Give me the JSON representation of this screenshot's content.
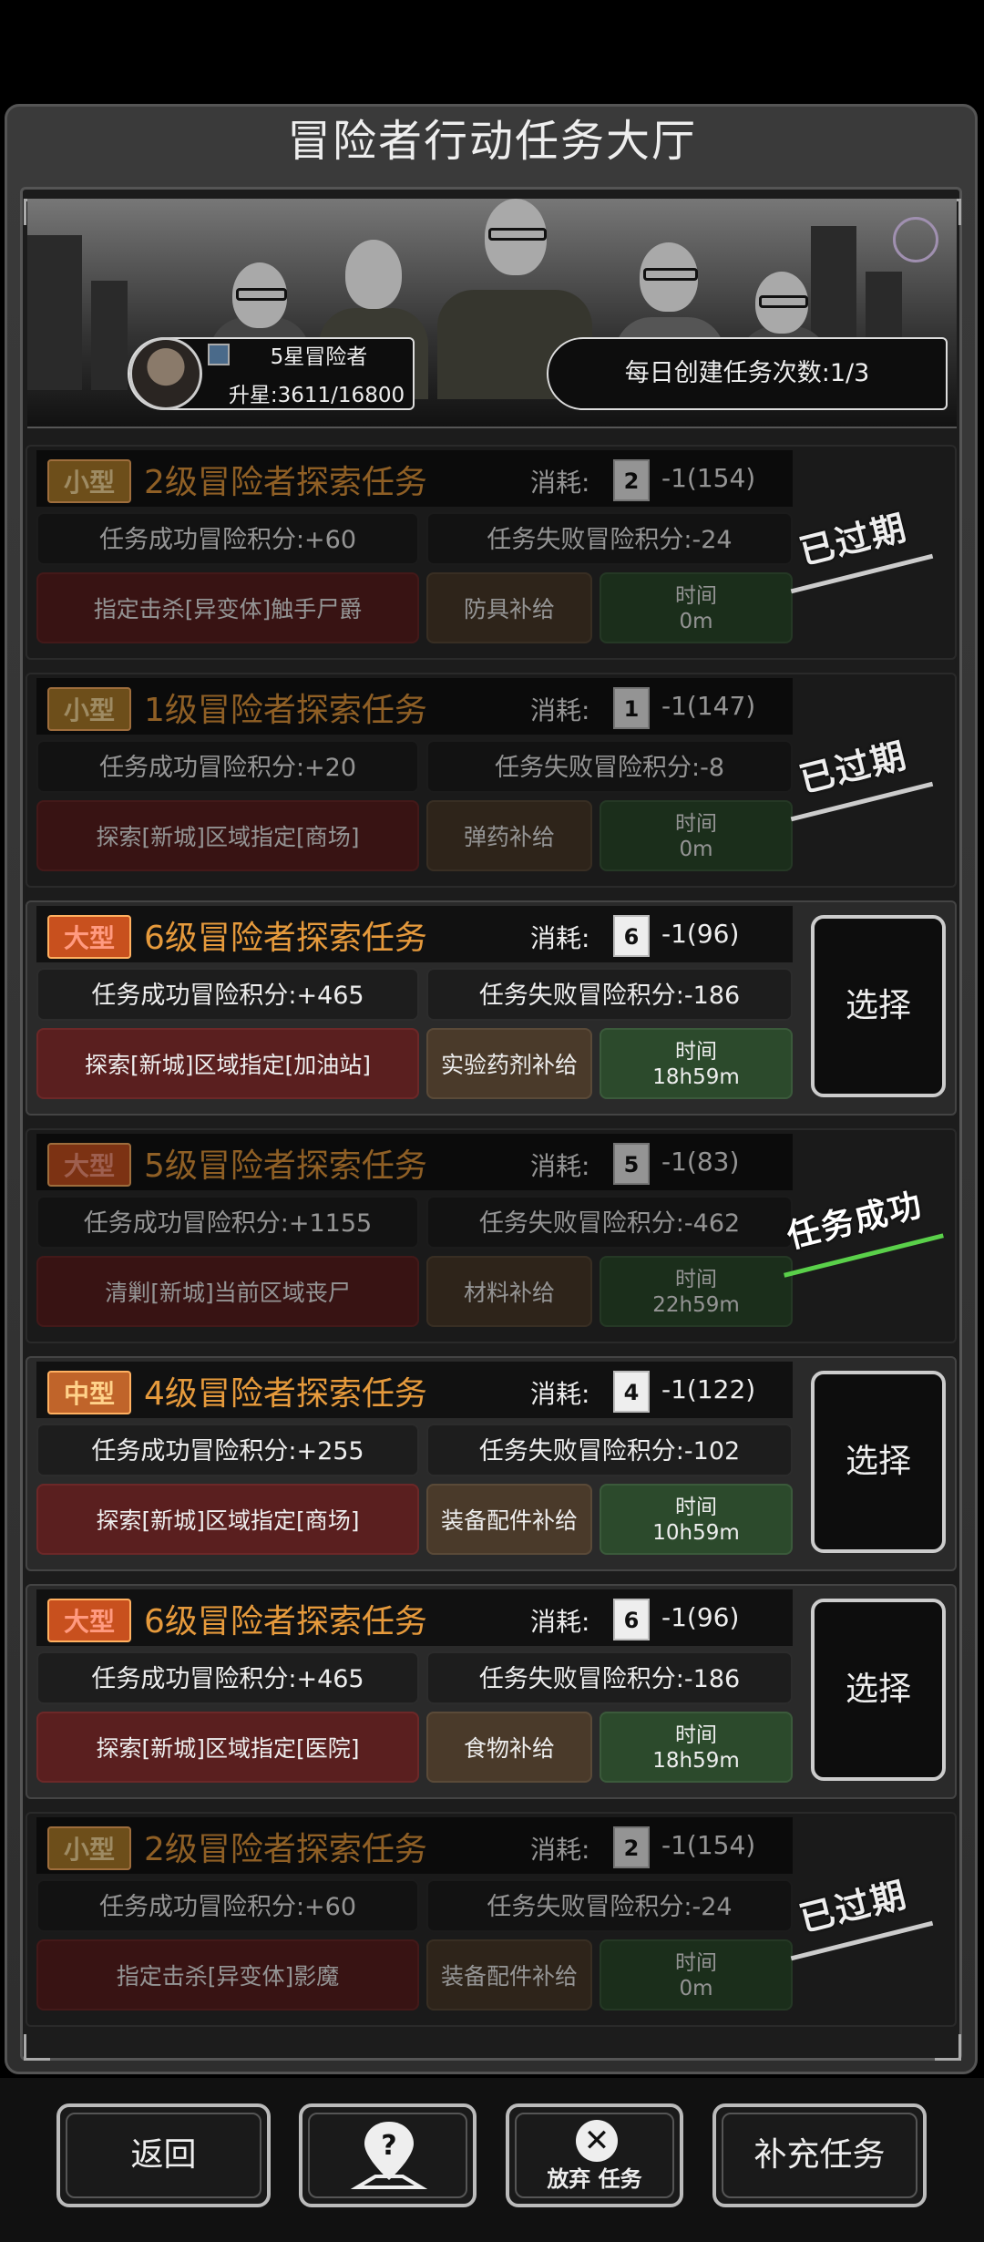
{
  "title": "冒险者行动任务大厅",
  "rank": {
    "name": "5星冒险者",
    "upgrade": "升星:3611/16800"
  },
  "daily": "每日创建任务次数:1/3",
  "tasks": [
    {
      "size": "小型",
      "name": "2级冒险者探索任务",
      "cost_label": "消耗:",
      "lv": "2",
      "cost": "-1(154)",
      "success": "任务成功冒险积分:+60",
      "fail": "任务失败冒险积分:-24",
      "objective": "指定击杀[异变体]触手尸爵",
      "supply": "防具补给",
      "time_label": "时间",
      "time": "0m",
      "status": "已过期"
    },
    {
      "size": "小型",
      "name": "1级冒险者探索任务",
      "cost_label": "消耗:",
      "lv": "1",
      "cost": "-1(147)",
      "success": "任务成功冒险积分:+20",
      "fail": "任务失败冒险积分:-8",
      "objective": "探索[新城]区域指定[商场]",
      "supply": "弹药补给",
      "time_label": "时间",
      "time": "0m",
      "status": "已过期"
    },
    {
      "size": "大型",
      "name": "6级冒险者探索任务",
      "cost_label": "消耗:",
      "lv": "6",
      "cost": "-1(96)",
      "success": "任务成功冒险积分:+465",
      "fail": "任务失败冒险积分:-186",
      "objective": "探索[新城]区域指定[加油站]",
      "supply": "实验药剂补给",
      "time_label": "时间",
      "time": "18h59m",
      "action": "选择"
    },
    {
      "size": "大型",
      "name": "5级冒险者探索任务",
      "cost_label": "消耗:",
      "lv": "5",
      "cost": "-1(83)",
      "success": "任务成功冒险积分:+1155",
      "fail": "任务失败冒险积分:-462",
      "objective": "清剿[新城]当前区域丧尸",
      "supply": "材料补给",
      "time_label": "时间",
      "time": "22h59m",
      "status": "任务成功"
    },
    {
      "size": "中型",
      "name": "4级冒险者探索任务",
      "cost_label": "消耗:",
      "lv": "4",
      "cost": "-1(122)",
      "success": "任务成功冒险积分:+255",
      "fail": "任务失败冒险积分:-102",
      "objective": "探索[新城]区域指定[商场]",
      "supply": "装备配件补给",
      "time_label": "时间",
      "time": "10h59m",
      "action": "选择"
    },
    {
      "size": "大型",
      "name": "6级冒险者探索任务",
      "cost_label": "消耗:",
      "lv": "6",
      "cost": "-1(96)",
      "success": "任务成功冒险积分:+465",
      "fail": "任务失败冒险积分:-186",
      "objective": "探索[新城]区域指定[医院]",
      "supply": "食物补给",
      "time_label": "时间",
      "time": "18h59m",
      "action": "选择"
    },
    {
      "size": "小型",
      "name": "2级冒险者探索任务",
      "cost_label": "消耗:",
      "lv": "2",
      "cost": "-1(154)",
      "success": "任务成功冒险积分:+60",
      "fail": "任务失败冒险积分:-24",
      "objective": "指定击杀[异变体]影魔",
      "supply": "装备配件补给",
      "time_label": "时间",
      "time": "0m",
      "status": "已过期"
    }
  ],
  "bottom": {
    "back": "返回",
    "help_icon": "question-map-icon",
    "abandon": "放弃 任务",
    "replenish": "补充任务"
  }
}
